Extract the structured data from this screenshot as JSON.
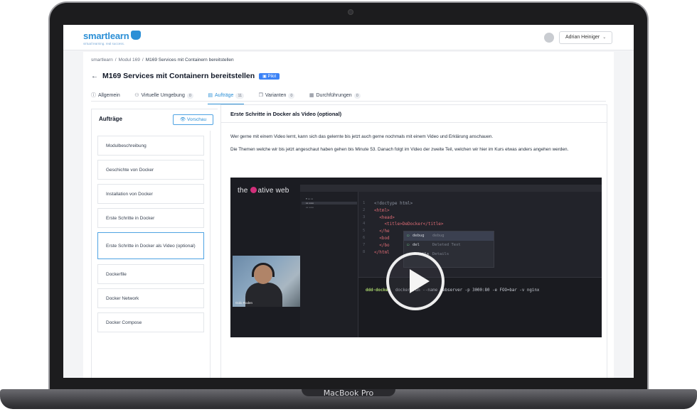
{
  "device": {
    "label": "MacBook Pro"
  },
  "header": {
    "logo": {
      "name": "smartlearn",
      "tagline": "virtual learning. real success."
    },
    "user": {
      "name": "Adrian Heiniger"
    }
  },
  "breadcrumb": [
    "smartlearn",
    "Modul 169",
    "M169 Services mit Containern bereitstellen"
  ],
  "page": {
    "title": "M169 Services mit Containern bereitstellen",
    "badge": "Pilot"
  },
  "tabs": [
    {
      "label": "Allgemein",
      "count": "",
      "icon": "info-icon"
    },
    {
      "label": "Virtuelle Umgebung",
      "count": "0",
      "icon": "network-icon"
    },
    {
      "label": "Aufträge",
      "count": "11",
      "icon": "document-icon",
      "active": true
    },
    {
      "label": "Varianten",
      "count": "0",
      "icon": "copy-icon"
    },
    {
      "label": "Durchführungen",
      "count": "0",
      "icon": "calendar-icon"
    }
  ],
  "left_panel": {
    "title": "Aufträge",
    "preview_label": "Vorschau",
    "items": [
      "Modulbeschreibung",
      "Geschichte von Docker",
      "Installation von Docker",
      "Erste Schritte in Docker",
      "Erste Schritte in Docker als Video (optional)",
      "Dockerfile",
      "Docker Network",
      "Docker Compose"
    ],
    "active_index": 4
  },
  "content": {
    "title": "Erste Schritte in Docker als Video (optional)",
    "paragraphs": [
      "Wer gerne mit einem Video lernt, kann sich das gelernte bis jetzt auch gerne nochmals mit einem Video und Erklärung anschauen.",
      "Die Themen welche wir bis jetzt angeschaut haben gehen bis Minute 53.  Danach folgt im Video der zweite Teil, welchen wir hier im Kurs etwas anders angehen werden."
    ]
  },
  "video": {
    "brand": {
      "before": "the ",
      "after": "ative web"
    },
    "presenter": "Golo Roden",
    "code_lines": [
      "<!doctype html>",
      "<html>",
      "  <head>",
      "    <title>DeDocker</title>",
      "  </he",
      "  <bod",
      "  </bo",
      "</html"
    ],
    "autocomplete": [
      {
        "text": "debug",
        "hint": "debug"
      },
      {
        "text": "del",
        "hint": "Deleted Text"
      },
      {
        "text": "details",
        "hint": "Details"
      }
    ],
    "terminal": {
      "prompt": "ddd-docker",
      "command": "docker run --name webserver -p 3000:80 -e FOO=bar -v nginx"
    }
  },
  "colors": {
    "accent": "#2b8fd6",
    "badge": "#3b82f6",
    "video_bg": "#1b1c22"
  }
}
